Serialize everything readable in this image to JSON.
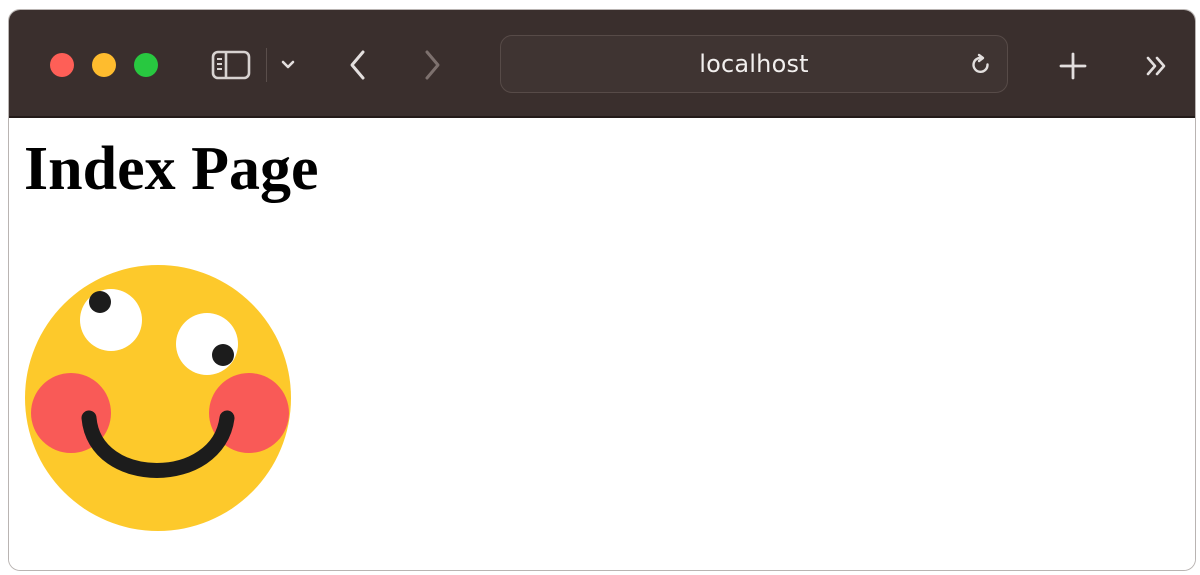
{
  "browser": {
    "address": "localhost",
    "icons": {
      "close": "close-traffic-light",
      "minimize": "minimize-traffic-light",
      "maximize": "maximize-traffic-light",
      "sidebar": "sidebar-icon",
      "tab_group_menu": "chevron-down-icon",
      "back": "chevron-left-icon",
      "forward": "chevron-right-icon",
      "reload": "reload-icon",
      "new_tab": "plus-icon",
      "more": "double-chevron-right-icon"
    },
    "colors": {
      "toolbar": "#3a2f2d",
      "close": "#fe5f57",
      "minimize": "#febc2e",
      "maximize": "#28c840"
    }
  },
  "page": {
    "title": "Index Page",
    "image": {
      "subject": "smiling-face-emoji",
      "colors": {
        "face": "#fdc92b",
        "cheeks": "#f95a57",
        "eyes": "#ffffff",
        "pupils": "#1c1c1c",
        "mouth": "#1c1c1c"
      }
    }
  }
}
